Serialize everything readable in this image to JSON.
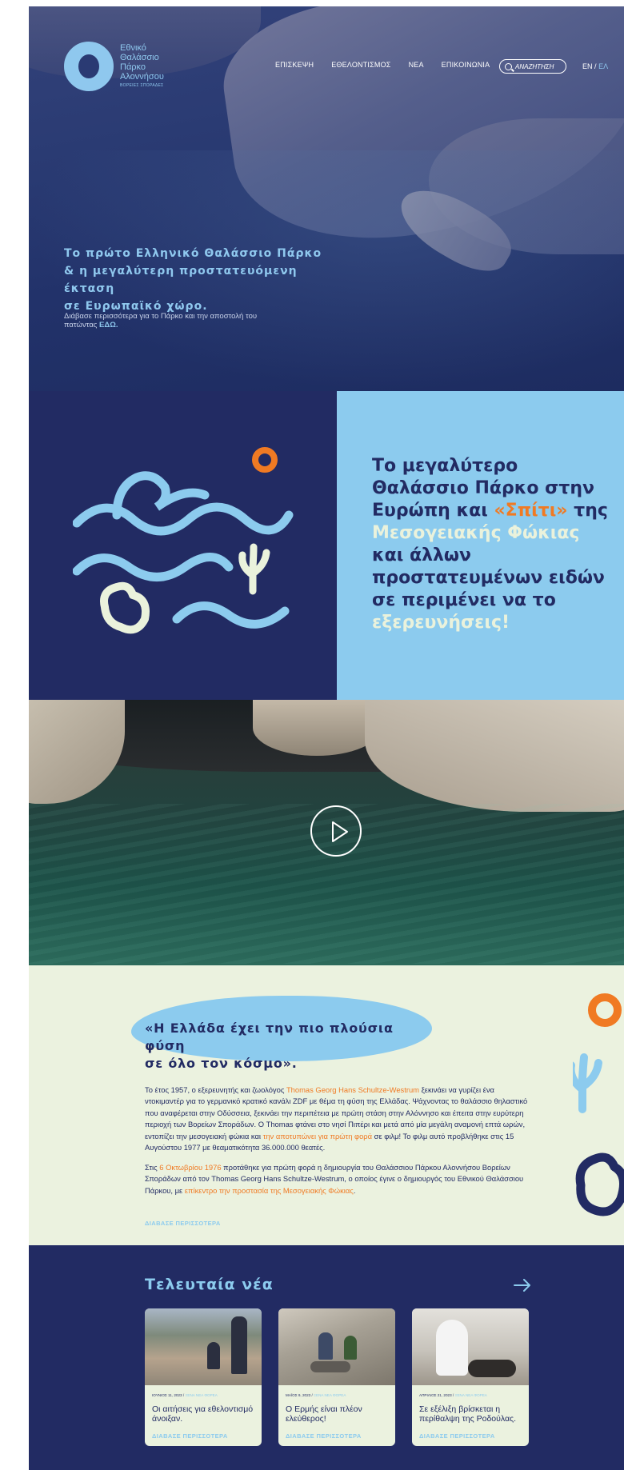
{
  "header": {
    "logo_lines": [
      "Εθνικό",
      "Θαλάσσιο",
      "Πάρκο",
      "Αλοννήσου"
    ],
    "logo_sub": "ΒΟΡΕΙΕΣ ΣΠΟΡΑΔΕΣ",
    "nav": [
      "ΕΠΙΣΚΕΨΗ",
      "ΕΘΕΛΟΝΤΙΣΜΟΣ",
      "ΝΕΑ",
      "ΕΠΙΚΟΙΝΩΝΙΑ"
    ],
    "search_label": "ΑΝΑΖΗΤΗΣΗ",
    "lang_en": "EN",
    "lang_sep": "/",
    "lang_el": "ΕΛ"
  },
  "hero": {
    "title_lines": [
      "Το πρώτο Ελληνικό Θαλάσσιο Πάρκο",
      "& η μεγαλύτερη προστατευόμενη έκταση",
      "σε Ευρωπαϊκό χώρο."
    ],
    "subtitle": "Διάβασε περισσότερα για το Πάρκο και την αποστολή του πατώντας",
    "subtitle_link": "ΕΔΩ."
  },
  "intro": {
    "h_part1": "Το μεγαλύτερο Θαλάσσιο Πάρκο στην Ευρώπη και ",
    "h_part2": "«Σπίτι»",
    "h_part3": " της ",
    "h_part4": "Μεσογειακής Φώκιας",
    "h_part5": " και άλλων προστατευμένων ειδών σε περιμένει να το ",
    "h_part6": "εξερευνήσεις!"
  },
  "story": {
    "quote_lines": [
      "«Η Ελλάδα έχει την πιο πλούσια φύση",
      "σε όλο τον κόσμο»."
    ],
    "p1_a": "Το έτος 1957, ο εξερευνητής και ζωολόγος ",
    "p1_b": "Thomas Georg Hans Schultze-Westrum",
    "p1_c": " ξεκινάει να γυρίζει ένα ντοκιμαντέρ για το γερμανικό κρατικό κανάλι ZDF με θέμα τη φύση της Ελλάδας. Ψάχνοντας το θαλάσσιο θηλαστικό που αναφέρεται στην Οδύσσεια, ξεκινάει την περιπέτεια με πρώτη στάση στην Αλόννησο και έπειτα στην ευρύτερη περιοχή των Βορείων Σποράδων. Ο Thomas φτάνει στο νησί Πιπέρι και μετά από μία μεγάλη αναμονή επτά ωρών, εντοπίζει την μεσογειακή φώκια και ",
    "p1_d": "την αποτυπώνει για πρώτη φορά",
    "p1_e": " σε φιλμ! Το φιλμ αυτό προβλήθηκε στις 15 Αυγούστου 1977 με θεαματικότητα 36.000.000 θεατές.",
    "p2_a": "Στις ",
    "p2_b": "6 Οκτωβρίου 1976",
    "p2_c": " προτάθηκε για πρώτη φορά η δημιουργία του Θαλάσσιου Πάρκου Αλοννήσου Βορείων Σποράδων από τον Thomas Georg Hans Schultze-Westrum, ο οποίος έγινε ο δημιουργός του Εθνικού Θαλάσσιου Πάρκου, με ",
    "p2_d": "επίκεντρο την προστασία της Μεσογειακής Φώκιας",
    "p2_e": ".",
    "read_more": "ΔΙΑΒΑΣΕ ΠΕΡΙΣΣΟΤΕΡΑ"
  },
  "news": {
    "title": "Τελευταία νέα",
    "cards": [
      {
        "date": "ΙΟΥΝΙΟΣ 11, 2023",
        "sep": "/",
        "category": "ΞΕΝΑ ΝΕΑ ΦΟΡΕΑ",
        "title": "Οι αιτήσεις για εθελοντισμό άνοιξαν.",
        "more": "ΔΙΑΒΑΣΕ ΠΕΡΙΣΣΟΤΕΡΑ"
      },
      {
        "date": "ΜΑΪΟΣ 9, 2023",
        "sep": "/",
        "category": "ΞΕΝΑ ΝΕΑ ΦΟΡΕΑ",
        "title": "Ο Ερμής είναι πλέον ελεύθερος!",
        "more": "ΔΙΑΒΑΣΕ ΠΕΡΙΣΣΟΤΕΡΑ"
      },
      {
        "date": "ΑΠΡΙΛΙΟΣ 21, 2023",
        "sep": "/",
        "category": "ΞΕΝΑ ΝΕΑ ΦΟΡΕΑ",
        "title": "Σε εξέλιξη βρίσκεται η περίθαλψη της Ροδούλας.",
        "more": "ΔΙΑΒΑΣΕ ΠΕΡΙΣΣΟΤΕΡΑ"
      }
    ]
  },
  "colors": {
    "navy": "#222b63",
    "light_blue": "#8ccbee",
    "orange": "#f07a23",
    "cream": "#ebf2df"
  }
}
